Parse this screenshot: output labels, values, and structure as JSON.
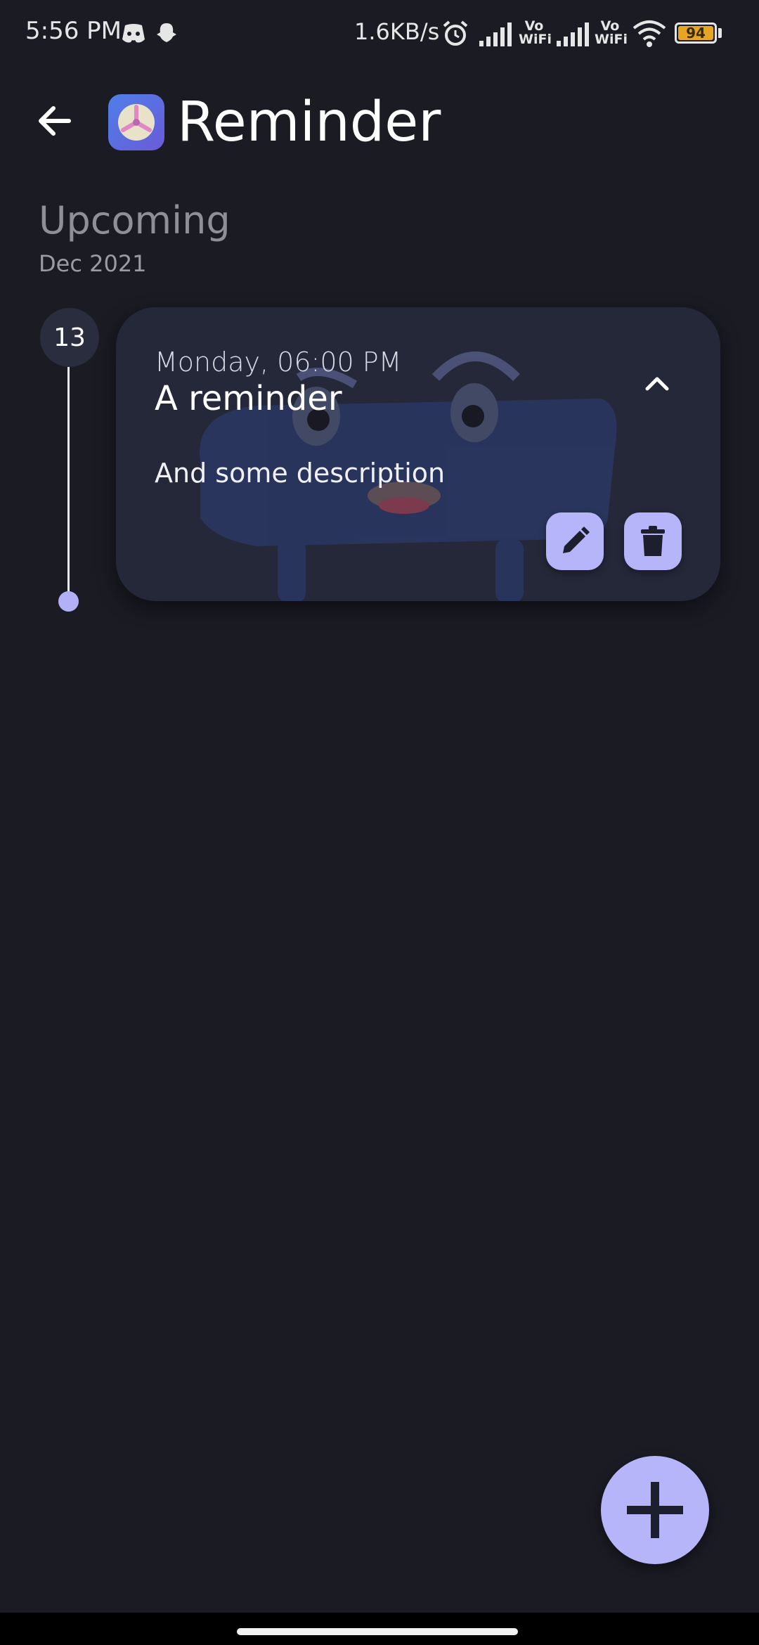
{
  "status_bar": {
    "time": "5:56 PM",
    "network_speed": "1.6KB/s",
    "vowifi_label_1": "Vo\nWiFi",
    "vowifi_label_2": "Vo\nWiFi",
    "battery_level": "94",
    "icons": [
      "discord-icon",
      "snapchat-icon",
      "alarm-icon",
      "signal-icon",
      "signal-icon",
      "wifi-icon",
      "battery-icon"
    ]
  },
  "app_bar": {
    "title": "Reminder",
    "back_icon": "arrow-back-icon",
    "app_icon": "app-logo-icon"
  },
  "section": {
    "title": "Upcoming",
    "month": "Dec 2021"
  },
  "reminders": [
    {
      "day": "13",
      "datetime": "Monday, 06:00 PM",
      "title": "A reminder",
      "description": "And some description",
      "expanded": true
    }
  ],
  "icons": {
    "collapse": "chevron-up-icon",
    "edit": "pencil-icon",
    "delete": "trash-icon",
    "add": "plus-icon"
  },
  "colors": {
    "background": "#1a1b23",
    "card": "#252839",
    "accent": "#b7b5fa",
    "muted_text": "#8e8f99"
  }
}
